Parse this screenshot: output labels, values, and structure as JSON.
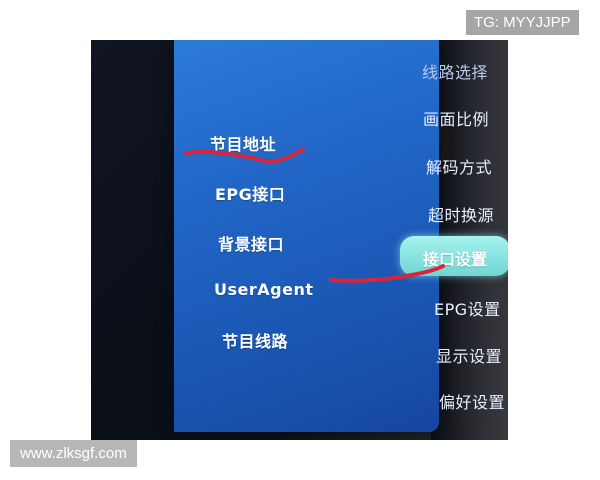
{
  "watermarks": {
    "top_right": "TG: MYYJJPP",
    "bottom_left": "www.zlksgf.com"
  },
  "menu": {
    "left_items": [
      {
        "label": "节目地址"
      },
      {
        "label": "EPG接口"
      },
      {
        "label": "背景接口"
      },
      {
        "label": "UserAgent"
      },
      {
        "label": "节目线路"
      }
    ],
    "right_items": [
      {
        "label": "线路选择"
      },
      {
        "label": "画面比例"
      },
      {
        "label": "解码方式"
      },
      {
        "label": "超时换源"
      },
      {
        "label": "接口设置",
        "selected": true
      },
      {
        "label": "EPG设置"
      },
      {
        "label": "显示设置"
      },
      {
        "label": "偏好设置"
      }
    ]
  },
  "colors": {
    "screen_blue": "#2166c6",
    "selected_highlight": "#7fdcd8",
    "annotation_red": "#d8253a"
  }
}
